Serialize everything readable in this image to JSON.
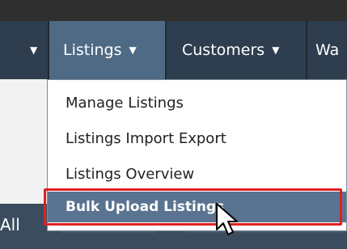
{
  "nav": {
    "partial_left_caret": "▼",
    "listings": {
      "label": "Listings",
      "caret": "▼"
    },
    "customers": {
      "label": "Customers",
      "caret": "▼"
    },
    "partial_right": "Wa"
  },
  "dropdown": {
    "items": [
      {
        "label": "Manage Listings"
      },
      {
        "label": "Listings Import Export"
      },
      {
        "label": "Listings Overview"
      },
      {
        "label": "Bulk Upload Listings",
        "highlighted": true
      }
    ]
  },
  "background": {
    "left_fragment": "All"
  },
  "annotation": {
    "highlight_color": "#e02020"
  },
  "icons": {
    "cursor": "arrow-cursor-icon"
  }
}
